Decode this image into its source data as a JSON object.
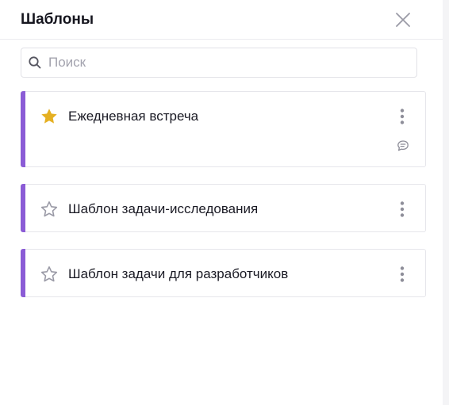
{
  "header": {
    "title": "Шаблоны",
    "close_icon": "close-icon"
  },
  "search": {
    "placeholder": "Поиск",
    "value": "",
    "icon": "search-icon"
  },
  "templates": [
    {
      "title": "Ежедневная встреча",
      "favorite": true,
      "accent_color": "#8b5cd6",
      "has_comment_icon": true
    },
    {
      "title": "Шаблон задачи-исследования",
      "favorite": false,
      "accent_color": "#8b5cd6",
      "has_comment_icon": false
    },
    {
      "title": "Шаблон задачи для разработчиков",
      "favorite": false,
      "accent_color": "#8b5cd6",
      "has_comment_icon": false
    }
  ],
  "colors": {
    "accent": "#8b5cd6",
    "star_filled": "#e5b022",
    "star_outline": "#9a9aa6",
    "icon_gray": "#8e8e99"
  }
}
